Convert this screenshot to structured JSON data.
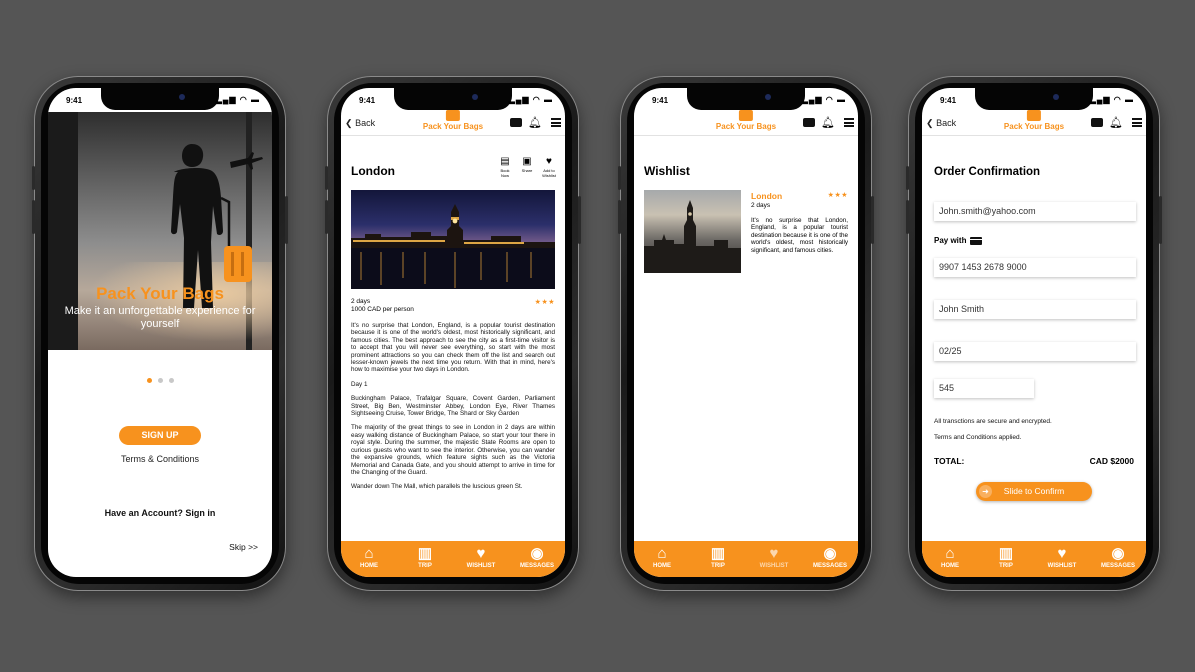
{
  "status": {
    "time": "9:41",
    "icons": "..ıl ᯤ ▬"
  },
  "brand": {
    "name": "Pack Your Bags"
  },
  "onboarding": {
    "title": "Pack Your Bags",
    "subtitle": "Make it an unforgettable experience for yourself",
    "signup_label": "SIGN UP",
    "terms_label": "Terms & Conditions",
    "signin_label": "Have an Account? Sign in",
    "skip_label": "Skip >>",
    "page_index": 1,
    "page_count": 3
  },
  "header": {
    "back_label": "Back"
  },
  "detail": {
    "city": "London",
    "actions": [
      {
        "label": "Book Now",
        "icon": "ticket-icon"
      },
      {
        "label": "Share",
        "icon": "share-icon"
      },
      {
        "label": "Add to Wishlist",
        "icon": "heart-icon"
      }
    ],
    "duration": "2 days",
    "price": "1000 CAD per person",
    "rating_stars": "★★★",
    "paragraphs": [
      "It's no surprise that London, England, is a popular tourist destination because it is one of the world's oldest, most historically significant, and famous cities. The best approach to see the city as a first-time visitor is to accept that you will never see everything, so start with the most prominent attractions so you can check them off the list and search out lesser-known jewels the next time you return. With that in mind, here's how to maximise your two days in London.",
      "Day 1",
      "Buckingham Palace, Trafalgar Square, Covent Garden, Parliament Street, Big Ben, Westminster Abbey, London Eye, River Thames Sightseeing Cruise, Tower Bridge, The Shard or Sky Garden",
      "The majority of the great things to see in London in 2 days are within easy walking distance of Buckingham Palace, so start your tour there in royal style. During the summer, the majestic State Rooms are open to curious guests who want to see the interior. Otherwise, you can wander the expansive grounds, which feature sights such as the Victoria Memorial and Canada Gate, and you should attempt to arrive in time for the Changing of the Guard.",
      "Wander down The Mall, which parallels the luscious green St."
    ]
  },
  "wishlist": {
    "title": "Wishlist",
    "items": [
      {
        "name": "London",
        "duration": "2 days",
        "stars": "★★★",
        "text": "It's no surprise that London, England, is a popular tourist destination because it is one of the world's oldest, most historically significant, and famous cities."
      }
    ]
  },
  "order": {
    "title": "Order Confirmation",
    "email": "John.smith@yahoo.com",
    "pay_with_label": "Pay with",
    "card_number": "9907 1453 2678 9000",
    "card_name": "John Smith",
    "expiry": "02/25",
    "cvv": "545",
    "secure_note": "All transctions are secure and encrypted.",
    "terms_note": "Terms and Conditions applied.",
    "total_label": "TOTAL:",
    "total_value": "CAD $2000",
    "slide_label": "Slide to Confirm"
  },
  "tabs": [
    {
      "label": "HOME",
      "icon": "home-icon"
    },
    {
      "label": "TRIP",
      "icon": "suitcase-icon"
    },
    {
      "label": "WISHLIST",
      "icon": "heart-icon"
    },
    {
      "label": "MESSAGES",
      "icon": "messenger-icon"
    }
  ],
  "colors": {
    "accent": "#f7921e",
    "background": "#555555"
  }
}
